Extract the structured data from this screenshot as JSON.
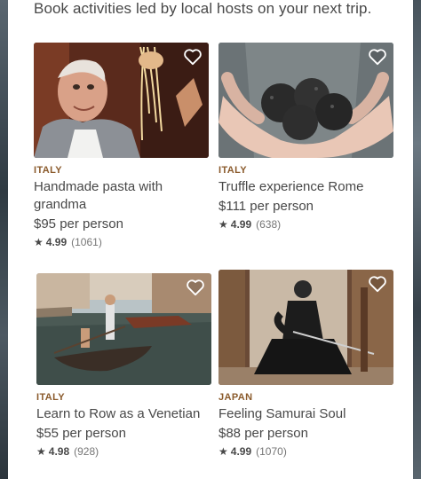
{
  "header": {
    "subtitle": "Book activities led by local hosts on your next trip."
  },
  "colors": {
    "country_italy": "#8a5a2b",
    "country_japan": "#8a5a2b",
    "text": "#484848"
  },
  "experiences": [
    {
      "country": "ITALY",
      "title": "Handmade pasta with grandma",
      "price": "$95 per person",
      "rating": "4.99",
      "reviews": "(1061)",
      "photo": "pasta-grandma-photo",
      "favorite_icon": "heart-icon"
    },
    {
      "country": "ITALY",
      "title": "Truffle experience Rome",
      "price": "$111 per person",
      "rating": "4.99",
      "reviews": "(638)",
      "photo": "truffle-hands-photo",
      "favorite_icon": "heart-icon"
    },
    {
      "country": "ITALY",
      "title": "Learn to Row as a Venetian",
      "price": "$55 per person",
      "rating": "4.98",
      "reviews": "(928)",
      "photo": "venice-gondola-photo",
      "favorite_icon": "heart-icon"
    },
    {
      "country": "JAPAN",
      "title": "Feeling Samurai Soul",
      "price": "$88 per person",
      "rating": "4.99",
      "reviews": "(1070)",
      "photo": "samurai-photo",
      "favorite_icon": "heart-icon"
    }
  ],
  "rating_icon": "star-icon"
}
